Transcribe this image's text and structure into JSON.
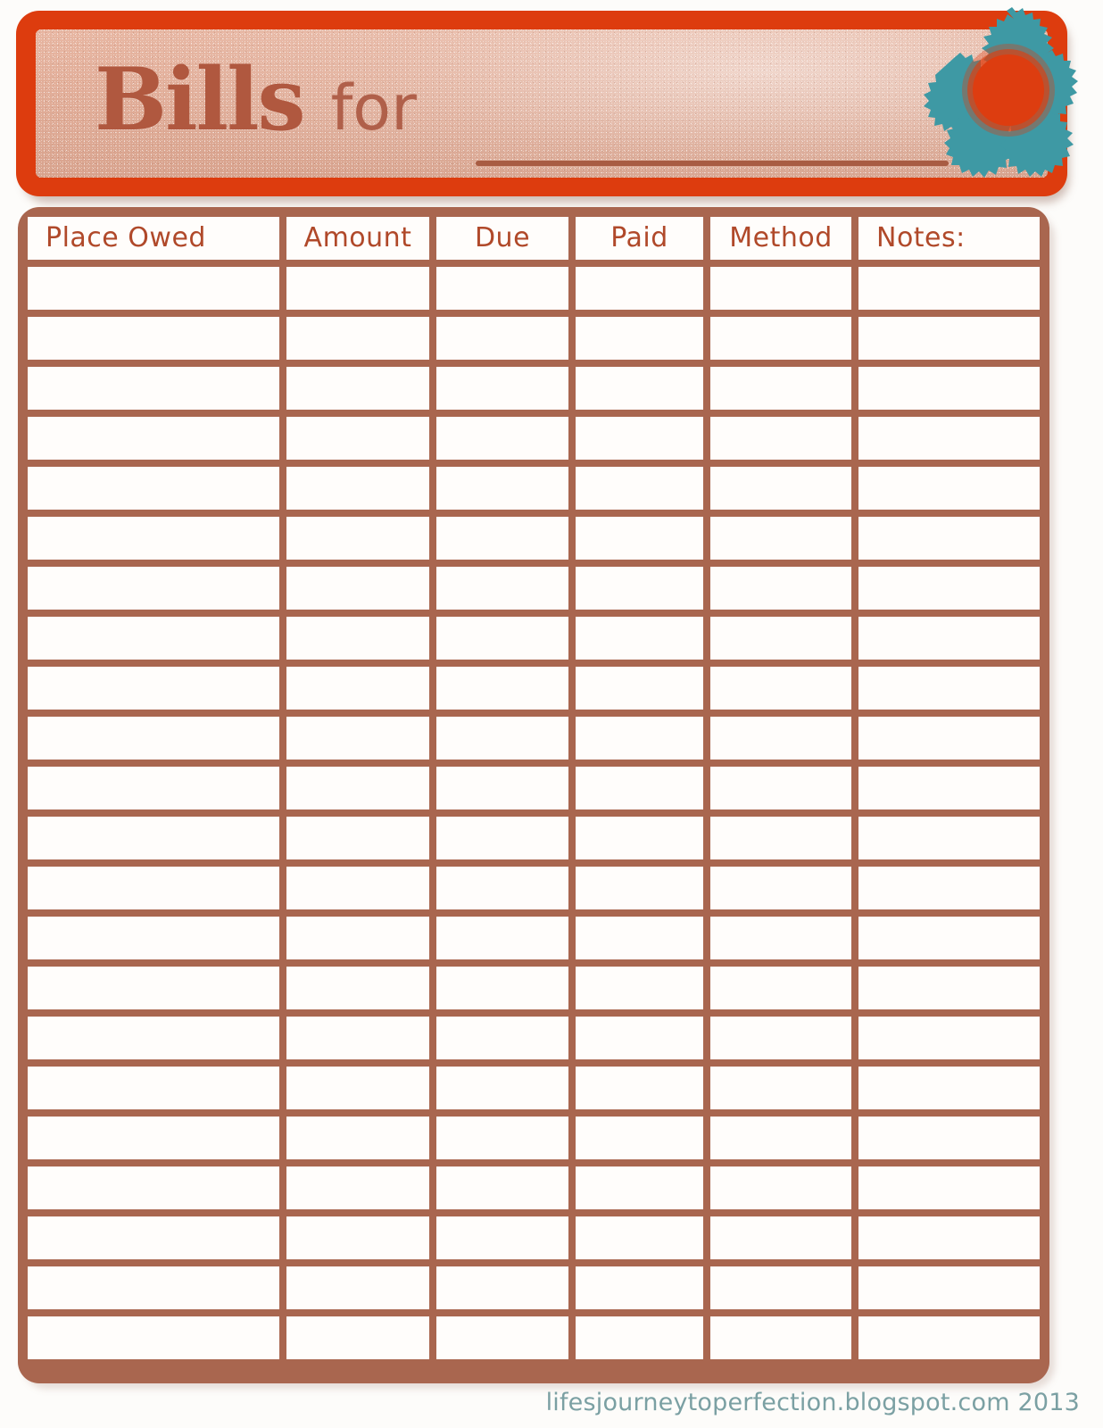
{
  "page": {
    "background_color": "#fdfcfa"
  },
  "header": {
    "title_primary": "Bills",
    "title_secondary": "for",
    "blank_line_label": "",
    "border_color": "#dd3c0e",
    "panel_color": "#e2ae99",
    "title_color": "#b0583f"
  },
  "decoration": {
    "flower_petal_color": "#3e99a4",
    "flower_center_color": "#dd3d10",
    "flower_name": "flower-graphic"
  },
  "table": {
    "border_color": "#a9664f",
    "cell_color": "#fffdfb",
    "header_text_color": "#b0492a",
    "columns": [
      {
        "key": "place_owed",
        "label": "Place Owed"
      },
      {
        "key": "amount",
        "label": "Amount"
      },
      {
        "key": "due",
        "label": "Due"
      },
      {
        "key": "paid",
        "label": "Paid"
      },
      {
        "key": "method",
        "label": "Method"
      },
      {
        "key": "notes",
        "label": "Notes:"
      }
    ],
    "row_count": 22,
    "rows": []
  },
  "footer": {
    "attribution": "lifesjourneytoperfection.blogspot.com 2013",
    "color": "#7ba0a3"
  }
}
